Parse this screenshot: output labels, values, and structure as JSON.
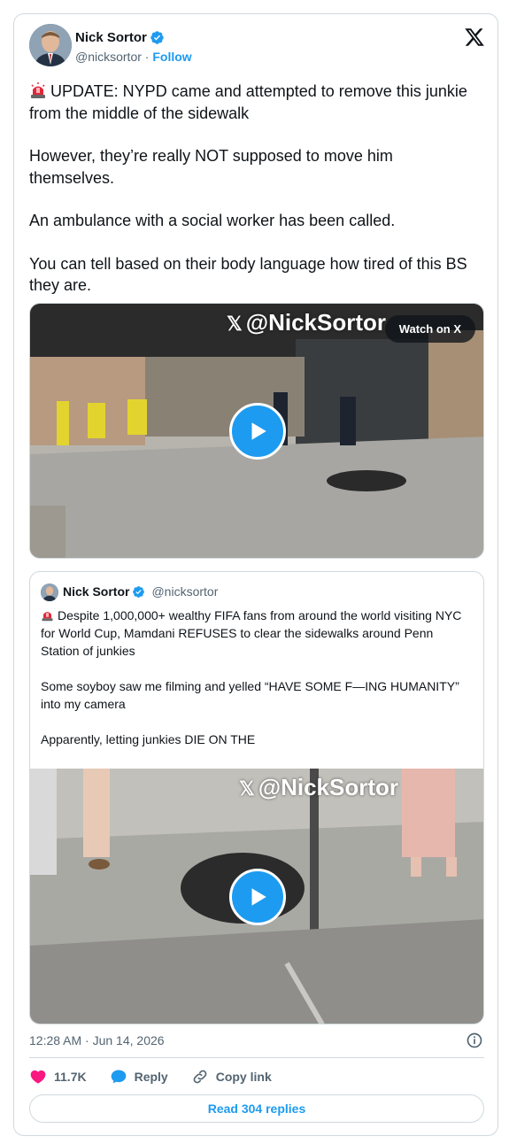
{
  "author": {
    "name": "Nick Sortor",
    "handle": "@nicksortor",
    "separator": "·",
    "follow_label": "Follow"
  },
  "tweet": {
    "paragraphs": [
      "UPDATE: NYPD came and attempted to remove this junkie from the middle of the sidewalk",
      "However, they’re really NOT supposed to move him themselves.",
      "An ambulance with a social worker has been called.",
      "You can tell based on their body language how tired of this BS they are."
    ],
    "lead_emoji": "rotating-light-icon"
  },
  "video": {
    "watermark": "@NickSortor",
    "watch_label": "Watch on X"
  },
  "quote": {
    "name": "Nick Sortor",
    "handle": "@nicksortor",
    "paragraphs": [
      "Despite 1,000,000+ wealthy FIFA fans from around the world visiting NYC for World Cup, Mamdani REFUSES to clear the sidewalks around Penn Station of junkies",
      "Some soyboy saw me filming and yelled “HAVE SOME F—ING HUMANITY” into my camera",
      "Apparently, letting junkies DIE ON THE"
    ],
    "video_watermark": "@NickSortor"
  },
  "meta": {
    "timestamp": "12:28 AM · Jun 14, 2026"
  },
  "actions": {
    "likes": "11.7K",
    "reply_label": "Reply",
    "copy_label": "Copy link"
  },
  "replies_button": "Read 304 replies",
  "colors": {
    "accent": "#1d9bf0",
    "heart": "#f91880",
    "secondary_text": "#536471",
    "border": "#cfd9de"
  }
}
